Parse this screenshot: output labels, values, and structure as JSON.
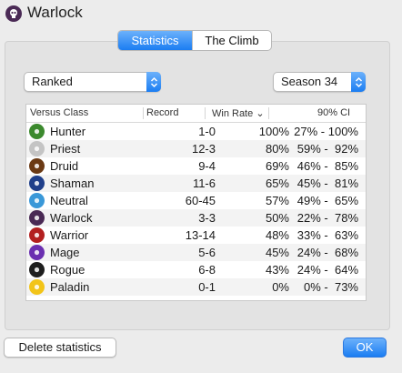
{
  "window": {
    "title": "Warlock",
    "icon": "warlock-skull-icon"
  },
  "tabs": [
    {
      "label": "Statistics",
      "active": true
    },
    {
      "label": "The Climb",
      "active": false
    }
  ],
  "filters": {
    "mode": "Ranked",
    "season": "Season 34"
  },
  "table": {
    "headers": {
      "class": "Versus Class",
      "record": "Record",
      "win_rate": "Win Rate",
      "ci": "90% CI"
    },
    "sort_indicator": "⌄",
    "rows": [
      {
        "class": "Hunter",
        "record": "1-0",
        "win_rate": "100%",
        "ci": "27% - 100%",
        "icon": "hunter-icon",
        "color": "#3c8a2e"
      },
      {
        "class": "Priest",
        "record": "12-3",
        "win_rate": "80%",
        "ci": "59% -  92%",
        "icon": "priest-icon",
        "color": "#c4c4c4"
      },
      {
        "class": "Druid",
        "record": "9-4",
        "win_rate": "69%",
        "ci": "46% -  85%",
        "icon": "druid-icon",
        "color": "#6b3a14"
      },
      {
        "class": "Shaman",
        "record": "11-6",
        "win_rate": "65%",
        "ci": "45% -  81%",
        "icon": "shaman-icon",
        "color": "#1f3f8a"
      },
      {
        "class": "Neutral",
        "record": "60-45",
        "win_rate": "57%",
        "ci": "49% -  65%",
        "icon": "neutral-icon",
        "color": "#3a98d8"
      },
      {
        "class": "Warlock",
        "record": "3-3",
        "win_rate": "50%",
        "ci": "22% -  78%",
        "icon": "warlock-icon",
        "color": "#4a2a55"
      },
      {
        "class": "Warrior",
        "record": "13-14",
        "win_rate": "48%",
        "ci": "33% -  63%",
        "icon": "warrior-icon",
        "color": "#b32020"
      },
      {
        "class": "Mage",
        "record": "5-6",
        "win_rate": "45%",
        "ci": "24% -  68%",
        "icon": "mage-icon",
        "color": "#6a2fb0"
      },
      {
        "class": "Rogue",
        "record": "6-8",
        "win_rate": "43%",
        "ci": "24% -  64%",
        "icon": "rogue-icon",
        "color": "#1e1e1e"
      },
      {
        "class": "Paladin",
        "record": "0-1",
        "win_rate": "0%",
        "ci": "0% -  73%",
        "icon": "paladin-icon",
        "color": "#f2c418"
      }
    ]
  },
  "buttons": {
    "delete": "Delete statistics",
    "ok": "OK"
  },
  "colors": {
    "accent": "#1b7df2"
  }
}
